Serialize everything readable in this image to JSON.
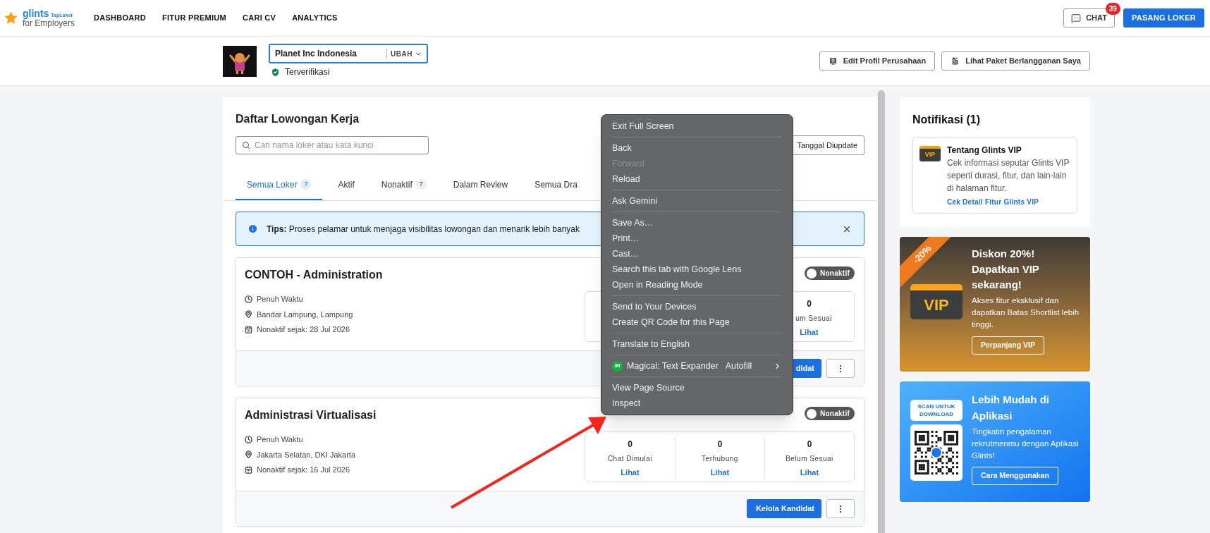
{
  "nav": {
    "logo": {
      "name": "glints",
      "tag": "TapLoker",
      "subtitle": "for Employers"
    },
    "links": [
      "DASHBOARD",
      "FITUR PREMIUM",
      "CARI CV",
      "ANALYTICS"
    ],
    "chat": {
      "label": "CHAT",
      "badge": "39"
    },
    "post_button": "PASANG LOKER"
  },
  "company": {
    "name": "Planet Inc Indonesia",
    "change": "UBAH",
    "verified": true,
    "verified_label": "Terverifikasi",
    "actions": [
      "Edit Profil Perusahaan",
      "Lihat Paket Berlangganan Saya"
    ]
  },
  "jobs": {
    "title": "Daftar Lowongan Kerja",
    "search": {
      "placeholder": "Cari nama loker atau kata kunci"
    },
    "sort": "Tanggal Diupdate",
    "tabs": [
      {
        "label": "Semua Loker",
        "count": "7",
        "selected": true
      },
      {
        "label": "Aktif",
        "selected": false
      },
      {
        "label": "Nonaktif",
        "count": "7",
        "selected": false
      },
      {
        "label": "Dalam Review",
        "selected": false
      },
      {
        "label": "Semua Dra",
        "selected": false
      }
    ],
    "tip": "**Tips:** Proses pelamar untuk menjaga visibilitas lowongan dan menarik lebih banyak",
    "cards": [
      {
        "title": "CONTOH - Administration",
        "type": "Penuh Waktu",
        "location": "Bandar Lampung, Lampung",
        "since": "Nonaktif sejak: 28 Jul 2026",
        "active": false,
        "status": "Nonaktif",
        "stats": [
          {
            "value": "0",
            "label": "um Sesuai",
            "link": "Lihat"
          }
        ],
        "manage": "didat"
      },
      {
        "title": "Administrasi Virtualisasi",
        "type": "Penuh Waktu",
        "location": "Jakarta Selatan, DKI Jakarta",
        "since": "Nonaktif sejak: 16 Jul 2026",
        "active": false,
        "status": "Nonaktif",
        "stats": [
          {
            "value": "0",
            "label": "Chat Dimulai",
            "link": "Lihat"
          },
          {
            "value": "0",
            "label": "Terhubung",
            "link": "Lihat"
          },
          {
            "value": "0",
            "label": "Belum Sesuai",
            "link": "Lihat"
          }
        ],
        "manage": "Kelola Kandidat"
      }
    ]
  },
  "context_menu": {
    "groups": [
      [
        {
          "label": "Exit Full Screen",
          "kind": "item",
          "disabled": false
        }
      ],
      [
        {
          "label": "Back",
          "kind": "item",
          "disabled": false
        },
        {
          "label": "Forward",
          "kind": "item",
          "disabled": true
        },
        {
          "label": "Reload",
          "kind": "item",
          "disabled": false
        }
      ],
      [
        {
          "label": "Ask Gemini",
          "kind": "item",
          "disabled": false
        }
      ],
      [
        {
          "label": "Save As…",
          "kind": "item",
          "disabled": false
        },
        {
          "label": "Print…",
          "kind": "item",
          "disabled": false
        },
        {
          "label": "Cast…",
          "kind": "item",
          "disabled": false
        },
        {
          "label": "Search this tab with Google Lens",
          "kind": "item",
          "disabled": false
        },
        {
          "label": "Open in Reading Mode",
          "kind": "item",
          "disabled": false
        }
      ],
      [
        {
          "label": "Send to Your Devices",
          "kind": "item",
          "disabled": false
        },
        {
          "label": "Create QR Code for this Page",
          "kind": "item",
          "disabled": false
        }
      ],
      [
        {
          "label": "Translate to English",
          "kind": "item",
          "disabled": false
        }
      ],
      [
        {
          "label": "Magical: Text Expander",
          "kind": "submenu",
          "icon_text": "IM",
          "shortcut": "Autofill",
          "disabled": false
        }
      ],
      [
        {
          "label": "View Page Source",
          "kind": "item",
          "disabled": false
        },
        {
          "label": "Inspect",
          "kind": "item",
          "disabled": false
        }
      ]
    ]
  },
  "notifications": {
    "title": "Notifikasi (1)",
    "items": [
      {
        "icon_text": "VIP",
        "title": "Tentang Glints VIP",
        "text": "Cek informasi seputar Glints VIP seperti durasi, fitur, dan lain-lain di halaman fitur.",
        "link": "Cek Detail Fitur Glints VIP"
      }
    ]
  },
  "promo": {
    "ribbon": "-20%",
    "badge": "VIP",
    "title": "Diskon 20%! Dapatkan VIP sekarang!",
    "text": "Akses fitur eksklusif dan dapatkan Batas Shortlist lebih tinggi.",
    "button": "Perpanjang VIP"
  },
  "app_promo": {
    "bubble": "SCAN UNTUK DOWNLOAD",
    "title": "Lebih Mudah di Aplikasi",
    "text": "Tingkatin pengalaman rekrutmenmu dengan Aplikasi Glints!",
    "button": "Cara Menggunakan"
  }
}
